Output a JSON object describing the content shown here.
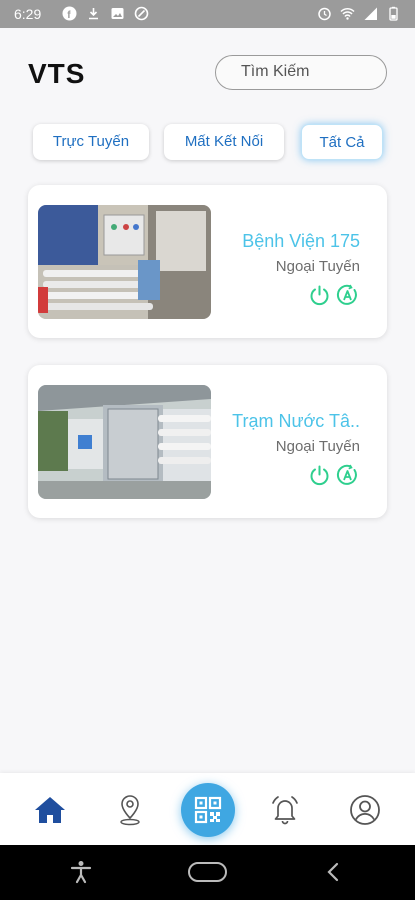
{
  "status_bar": {
    "time": "6:29",
    "left_icons": [
      "facebook-icon",
      "download-icon",
      "image-icon",
      "settings-icon"
    ],
    "right_icons": [
      "alarm-icon",
      "wifi-icon",
      "signal-icon",
      "battery-icon"
    ]
  },
  "header": {
    "app_title": "VTS",
    "search_placeholder": "Tìm Kiếm"
  },
  "filters": {
    "online": "Trực Tuyến",
    "disconnected": "Mất Kết Nối",
    "all": "Tất Cả",
    "active": "all"
  },
  "stations": [
    {
      "name": "Bệnh Viện 175",
      "status": "Ngoại Tuyến"
    },
    {
      "name": "Trạm Nước Tâ..",
      "status": "Ngoại Tuyến"
    }
  ],
  "bottom_nav": {
    "items": [
      "home-icon",
      "location-icon",
      "qr-code-icon",
      "bell-icon",
      "user-icon"
    ],
    "active": "home-icon"
  },
  "colors": {
    "accent": "#4cc3e8",
    "link_blue": "#1f6fc1",
    "qr_button": "#3fa7e2",
    "control_green": "#2ecf8e",
    "home_active": "#1f4e9e"
  }
}
